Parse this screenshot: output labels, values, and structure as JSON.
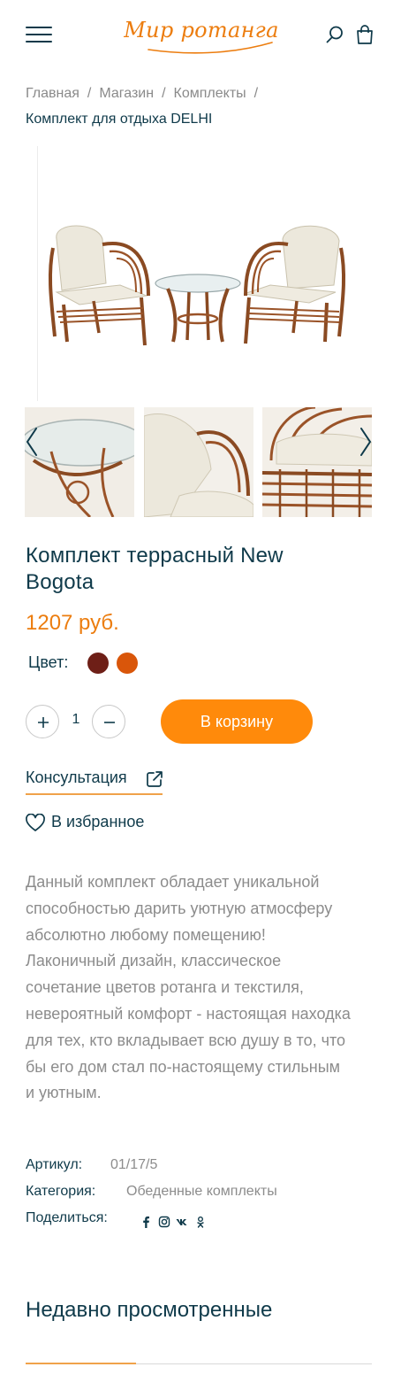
{
  "header": {
    "logo_text": "Мир ротанга",
    "menu_icon": "hamburger-menu-icon",
    "search_icon": "search-icon",
    "cart_icon": "shopping-bag-icon"
  },
  "breadcrumbs": {
    "items": [
      "Главная",
      "Магазин",
      "Комплекты"
    ],
    "separator": "/",
    "current": "Комплект для отдыха DELHI"
  },
  "gallery": {
    "prev_icon": "chevron-left-icon",
    "next_icon": "chevron-right-icon"
  },
  "product": {
    "title": "Комплект террасный New Bogota",
    "price": "1207 руб.",
    "color_label": "Цвет:",
    "colors": [
      "#6e1f17",
      "#d9560a"
    ],
    "quantity": "1",
    "add_to_cart": "В корзину",
    "consultation": "Консультация",
    "favorite": "В избранное",
    "description": "Данный комплект обладает уникальной способностью дарить уютную атмосферу абсолютно любому помещению! Лаконичный дизайн, классическое сочетание цветов ротанга и текстиля, невероятный комфорт - настоящая находка для тех, кто вкладывает всю душу в то, что бы его дом стал по-настоящему стильным и уютным."
  },
  "meta": {
    "sku_label": "Артикул:",
    "sku": "01/17/5",
    "category_label": "Категория:",
    "category": "Обеденные комплекты",
    "share_label": "Поделиться:",
    "share_icons": [
      "facebook-icon",
      "instagram-icon",
      "vk-icon",
      "odnoklassniki-icon"
    ]
  },
  "recent": {
    "title": "Недавно просмотренные"
  },
  "colors": {
    "accent": "#ff8a0b",
    "text_dark": "#0f3a4a",
    "text_muted": "#8c8c8c"
  }
}
